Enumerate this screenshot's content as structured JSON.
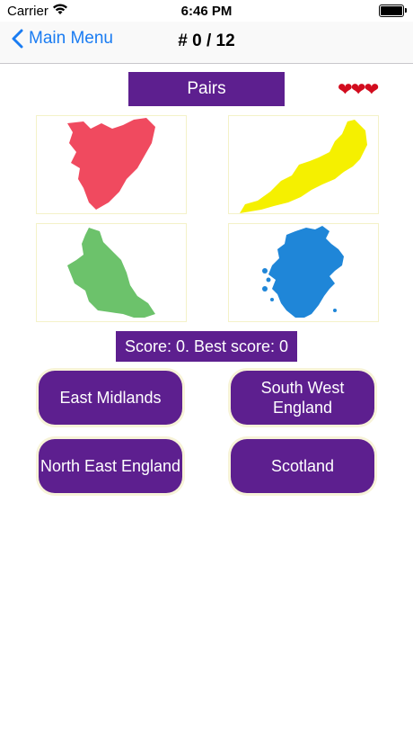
{
  "status_bar": {
    "carrier": "Carrier",
    "time": "6:46 PM"
  },
  "nav": {
    "back_label": "Main Menu",
    "title": "# 0 / 12"
  },
  "game": {
    "mode_label": "Pairs",
    "lives_icons": "❤❤❤",
    "score_text": "Score: 0. Best score: 0"
  },
  "maps": [
    {
      "color": "#f04a5f",
      "icon": "red-region-map"
    },
    {
      "color": "#f5f000",
      "icon": "yellow-region-map"
    },
    {
      "color": "#6cc26b",
      "icon": "green-region-map"
    },
    {
      "color": "#1f86d8",
      "icon": "blue-region-map"
    }
  ],
  "answers": [
    {
      "label": "East Midlands"
    },
    {
      "label": "South West\nEngland"
    },
    {
      "label": "North East England"
    },
    {
      "label": "Scotland"
    }
  ],
  "colors": {
    "accent": "#5d1f8f",
    "link": "#1a7cf2"
  }
}
